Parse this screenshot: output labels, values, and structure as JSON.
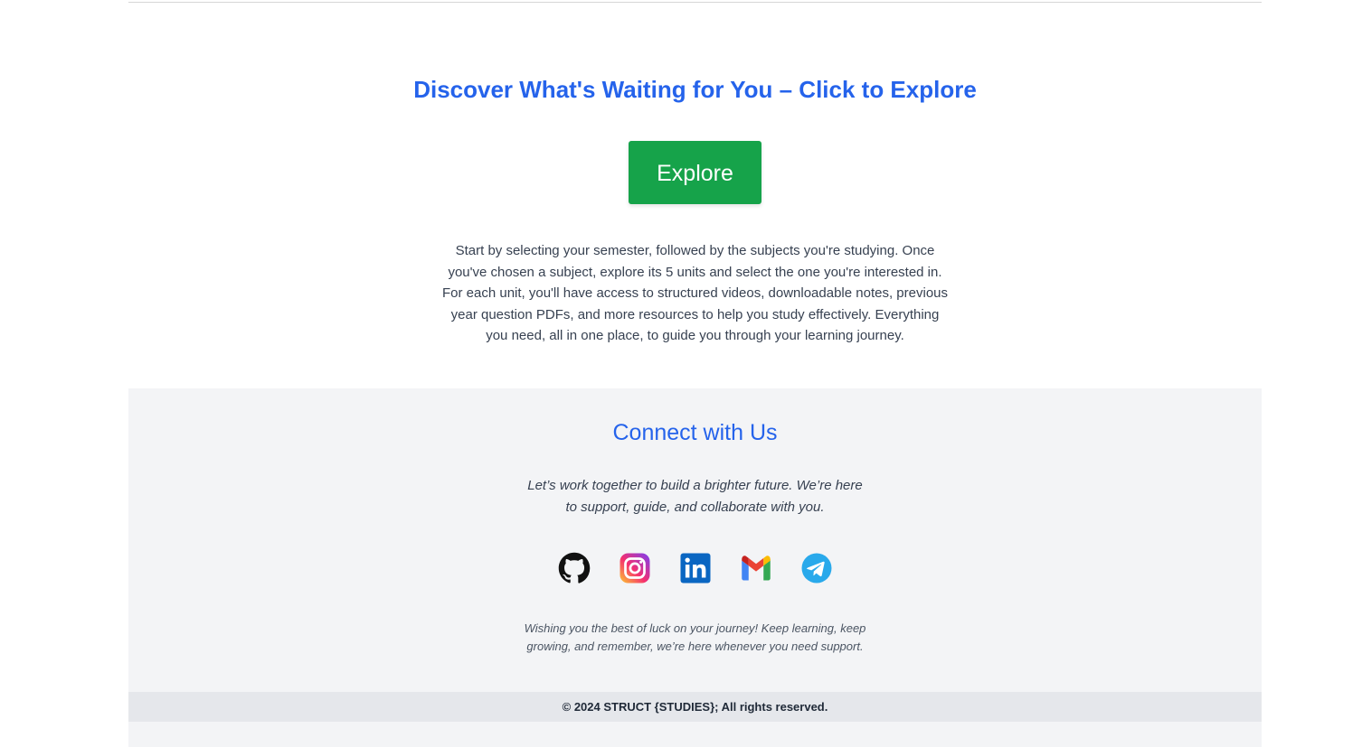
{
  "hero": {
    "title": "Discover What's Waiting for You – Click to Explore",
    "button_label": "Explore",
    "description": "Start by selecting your semester, followed by the subjects you're studying. Once you've chosen a subject, explore its 5 units and select the one you're interested in. For each unit, you'll have access to structured videos, downloadable notes, previous year question PDFs, and more resources to help you study effectively. Everything you need, all in one place, to guide you through your learning journey."
  },
  "footer": {
    "title": "Connect with Us",
    "tagline": "Let’s work together to build a brighter future. We’re here to support, guide, and collaborate with you.",
    "social_links": [
      {
        "name": "github",
        "icon": "github-icon"
      },
      {
        "name": "instagram",
        "icon": "instagram-icon"
      },
      {
        "name": "linkedin",
        "icon": "linkedin-icon"
      },
      {
        "name": "gmail",
        "icon": "gmail-icon"
      },
      {
        "name": "telegram",
        "icon": "telegram-icon"
      }
    ],
    "wish": "Wishing you the best of luck on your journey! Keep learning, keep growing, and remember, we’re here whenever you need support.",
    "copyright": "© 2024 STRUCT {STUDIES}; All rights reserved."
  },
  "colors": {
    "accent_blue": "#2563eb",
    "button_green": "#16a34a",
    "footer_bg": "#f3f4f6",
    "copyright_bg": "#e5e7eb"
  }
}
